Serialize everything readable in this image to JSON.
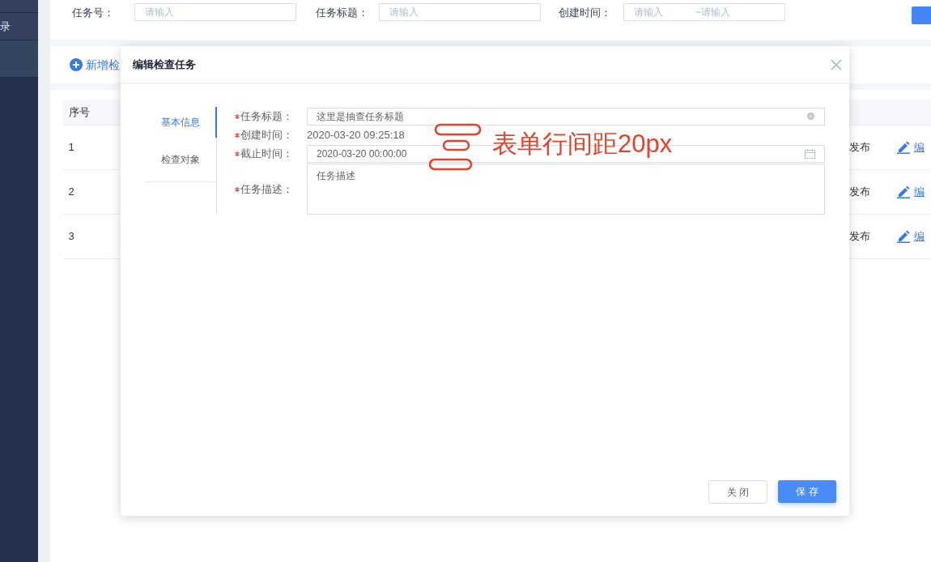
{
  "sidebar": {
    "items": [
      {
        "label": "录",
        "selected": false
      },
      {
        "selected": true
      }
    ]
  },
  "filters": [
    {
      "label": "任务号：",
      "kind": "text",
      "placeholder": "请输入"
    },
    {
      "label": "任务标题：",
      "kind": "text",
      "placeholder": "请输入"
    },
    {
      "label": "创建时间：",
      "kind": "range",
      "placeholder": "请输入",
      "placeholder_end": "~请输入"
    }
  ],
  "toolbar": {
    "add_button": "新增检"
  },
  "table": {
    "columns": [
      "序号"
    ],
    "rows": [
      {
        "index": "1",
        "status": "发布",
        "action": "编"
      },
      {
        "index": "2",
        "status": "发布",
        "action": "编"
      },
      {
        "index": "3",
        "status": "发布",
        "action": "编"
      }
    ]
  },
  "modal": {
    "title": "编辑检查任务",
    "tabs": [
      {
        "label": "基本信息",
        "selected": true
      },
      {
        "label": "检查对象",
        "selected": false
      }
    ],
    "fields": [
      {
        "label": "任务标题：",
        "required": true,
        "kind": "input",
        "value": "这里是抽查任务标题",
        "clearable": true
      },
      {
        "label": "创建时间：",
        "required": true,
        "kind": "text",
        "value": "2020-03-20 09:25:18"
      },
      {
        "label": "截止时间：",
        "required": true,
        "kind": "date",
        "value": "2020-03-20 00:00:00"
      },
      {
        "label": "任务描述：",
        "required": true,
        "kind": "textarea",
        "value": "任务描述"
      }
    ],
    "buttons": [
      {
        "label": "关 闭",
        "kind": "default"
      },
      {
        "label": "保 存",
        "kind": "primary"
      }
    ]
  },
  "annotation": {
    "text": "表单行间距20px"
  }
}
